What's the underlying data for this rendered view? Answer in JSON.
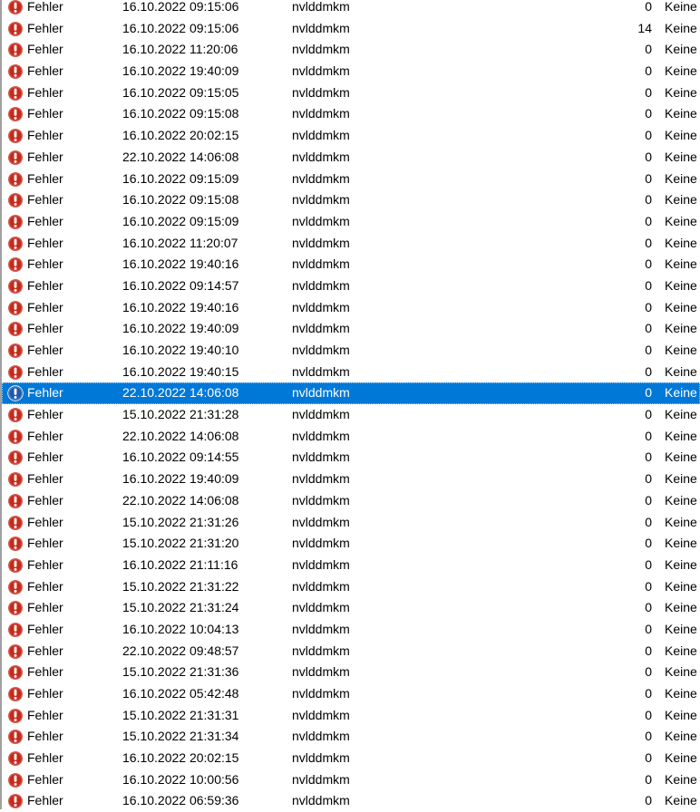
{
  "colors": {
    "error_icon": "#c42b1c",
    "selected_icon": "#1e5aa8",
    "selection_background": "#0078d7",
    "selection_text": "#ffffff"
  },
  "events": [
    {
      "level": "Fehler",
      "icon": "error-icon",
      "datetime": "16.10.2022 09:15:06",
      "source": "nvlddmkm",
      "event_id": "0",
      "category": "Keine"
    },
    {
      "level": "Fehler",
      "icon": "error-icon",
      "datetime": "16.10.2022 09:15:06",
      "source": "nvlddmkm",
      "event_id": "14",
      "category": "Keine"
    },
    {
      "level": "Fehler",
      "icon": "error-icon",
      "datetime": "16.10.2022 11:20:06",
      "source": "nvlddmkm",
      "event_id": "0",
      "category": "Keine"
    },
    {
      "level": "Fehler",
      "icon": "error-icon",
      "datetime": "16.10.2022 19:40:09",
      "source": "nvlddmkm",
      "event_id": "0",
      "category": "Keine"
    },
    {
      "level": "Fehler",
      "icon": "error-icon",
      "datetime": "16.10.2022 09:15:05",
      "source": "nvlddmkm",
      "event_id": "0",
      "category": "Keine"
    },
    {
      "level": "Fehler",
      "icon": "error-icon",
      "datetime": "16.10.2022 09:15:08",
      "source": "nvlddmkm",
      "event_id": "0",
      "category": "Keine"
    },
    {
      "level": "Fehler",
      "icon": "error-icon",
      "datetime": "16.10.2022 20:02:15",
      "source": "nvlddmkm",
      "event_id": "0",
      "category": "Keine"
    },
    {
      "level": "Fehler",
      "icon": "error-icon",
      "datetime": "22.10.2022 14:06:08",
      "source": "nvlddmkm",
      "event_id": "0",
      "category": "Keine"
    },
    {
      "level": "Fehler",
      "icon": "error-icon",
      "datetime": "16.10.2022 09:15:09",
      "source": "nvlddmkm",
      "event_id": "0",
      "category": "Keine"
    },
    {
      "level": "Fehler",
      "icon": "error-icon",
      "datetime": "16.10.2022 09:15:08",
      "source": "nvlddmkm",
      "event_id": "0",
      "category": "Keine"
    },
    {
      "level": "Fehler",
      "icon": "error-icon",
      "datetime": "16.10.2022 09:15:09",
      "source": "nvlddmkm",
      "event_id": "0",
      "category": "Keine"
    },
    {
      "level": "Fehler",
      "icon": "error-icon",
      "datetime": "16.10.2022 11:20:07",
      "source": "nvlddmkm",
      "event_id": "0",
      "category": "Keine"
    },
    {
      "level": "Fehler",
      "icon": "error-icon",
      "datetime": "16.10.2022 19:40:16",
      "source": "nvlddmkm",
      "event_id": "0",
      "category": "Keine"
    },
    {
      "level": "Fehler",
      "icon": "error-icon",
      "datetime": "16.10.2022 09:14:57",
      "source": "nvlddmkm",
      "event_id": "0",
      "category": "Keine"
    },
    {
      "level": "Fehler",
      "icon": "error-icon",
      "datetime": "16.10.2022 19:40:16",
      "source": "nvlddmkm",
      "event_id": "0",
      "category": "Keine"
    },
    {
      "level": "Fehler",
      "icon": "error-icon",
      "datetime": "16.10.2022 19:40:09",
      "source": "nvlddmkm",
      "event_id": "0",
      "category": "Keine"
    },
    {
      "level": "Fehler",
      "icon": "error-icon",
      "datetime": "16.10.2022 19:40:10",
      "source": "nvlddmkm",
      "event_id": "0",
      "category": "Keine"
    },
    {
      "level": "Fehler",
      "icon": "error-icon",
      "datetime": "16.10.2022 19:40:15",
      "source": "nvlddmkm",
      "event_id": "0",
      "category": "Keine"
    },
    {
      "level": "Fehler",
      "icon": "error-icon",
      "datetime": "22.10.2022 14:06:08",
      "source": "nvlddmkm",
      "event_id": "0",
      "category": "Keine",
      "selected": true
    },
    {
      "level": "Fehler",
      "icon": "error-icon",
      "datetime": "15.10.2022 21:31:28",
      "source": "nvlddmkm",
      "event_id": "0",
      "category": "Keine"
    },
    {
      "level": "Fehler",
      "icon": "error-icon",
      "datetime": "22.10.2022 14:06:08",
      "source": "nvlddmkm",
      "event_id": "0",
      "category": "Keine"
    },
    {
      "level": "Fehler",
      "icon": "error-icon",
      "datetime": "16.10.2022 09:14:55",
      "source": "nvlddmkm",
      "event_id": "0",
      "category": "Keine"
    },
    {
      "level": "Fehler",
      "icon": "error-icon",
      "datetime": "16.10.2022 19:40:09",
      "source": "nvlddmkm",
      "event_id": "0",
      "category": "Keine"
    },
    {
      "level": "Fehler",
      "icon": "error-icon",
      "datetime": "22.10.2022 14:06:08",
      "source": "nvlddmkm",
      "event_id": "0",
      "category": "Keine"
    },
    {
      "level": "Fehler",
      "icon": "error-icon",
      "datetime": "15.10.2022 21:31:26",
      "source": "nvlddmkm",
      "event_id": "0",
      "category": "Keine"
    },
    {
      "level": "Fehler",
      "icon": "error-icon",
      "datetime": "15.10.2022 21:31:20",
      "source": "nvlddmkm",
      "event_id": "0",
      "category": "Keine"
    },
    {
      "level": "Fehler",
      "icon": "error-icon",
      "datetime": "16.10.2022 21:11:16",
      "source": "nvlddmkm",
      "event_id": "0",
      "category": "Keine"
    },
    {
      "level": "Fehler",
      "icon": "error-icon",
      "datetime": "15.10.2022 21:31:22",
      "source": "nvlddmkm",
      "event_id": "0",
      "category": "Keine"
    },
    {
      "level": "Fehler",
      "icon": "error-icon",
      "datetime": "15.10.2022 21:31:24",
      "source": "nvlddmkm",
      "event_id": "0",
      "category": "Keine"
    },
    {
      "level": "Fehler",
      "icon": "error-icon",
      "datetime": "16.10.2022 10:04:13",
      "source": "nvlddmkm",
      "event_id": "0",
      "category": "Keine"
    },
    {
      "level": "Fehler",
      "icon": "error-icon",
      "datetime": "22.10.2022 09:48:57",
      "source": "nvlddmkm",
      "event_id": "0",
      "category": "Keine"
    },
    {
      "level": "Fehler",
      "icon": "error-icon",
      "datetime": "15.10.2022 21:31:36",
      "source": "nvlddmkm",
      "event_id": "0",
      "category": "Keine"
    },
    {
      "level": "Fehler",
      "icon": "error-icon",
      "datetime": "16.10.2022 05:42:48",
      "source": "nvlddmkm",
      "event_id": "0",
      "category": "Keine"
    },
    {
      "level": "Fehler",
      "icon": "error-icon",
      "datetime": "15.10.2022 21:31:31",
      "source": "nvlddmkm",
      "event_id": "0",
      "category": "Keine"
    },
    {
      "level": "Fehler",
      "icon": "error-icon",
      "datetime": "15.10.2022 21:31:34",
      "source": "nvlddmkm",
      "event_id": "0",
      "category": "Keine"
    },
    {
      "level": "Fehler",
      "icon": "error-icon",
      "datetime": "16.10.2022 20:02:15",
      "source": "nvlddmkm",
      "event_id": "0",
      "category": "Keine"
    },
    {
      "level": "Fehler",
      "icon": "error-icon",
      "datetime": "16.10.2022 10:00:56",
      "source": "nvlddmkm",
      "event_id": "0",
      "category": "Keine"
    },
    {
      "level": "Fehler",
      "icon": "error-icon",
      "datetime": "16.10.2022 06:59:36",
      "source": "nvlddmkm",
      "event_id": "0",
      "category": "Keine"
    }
  ]
}
